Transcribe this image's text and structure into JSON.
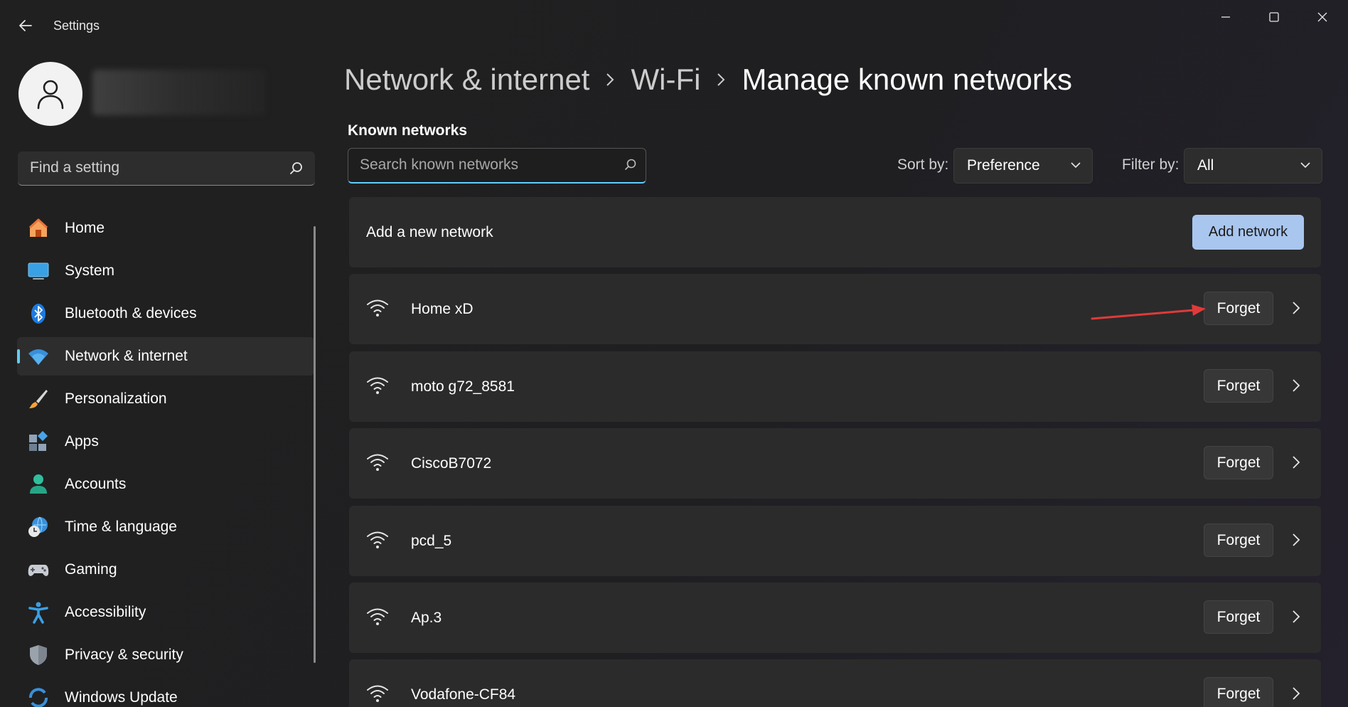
{
  "window": {
    "title": "Settings"
  },
  "sidebar": {
    "search_placeholder": "Find a setting",
    "items": [
      {
        "label": "Home",
        "icon": "home-icon"
      },
      {
        "label": "System",
        "icon": "system-icon"
      },
      {
        "label": "Bluetooth & devices",
        "icon": "bluetooth-icon"
      },
      {
        "label": "Network & internet",
        "icon": "wifi-icon",
        "active": true
      },
      {
        "label": "Personalization",
        "icon": "brush-icon"
      },
      {
        "label": "Apps",
        "icon": "apps-icon"
      },
      {
        "label": "Accounts",
        "icon": "account-icon"
      },
      {
        "label": "Time & language",
        "icon": "clock-globe-icon"
      },
      {
        "label": "Gaming",
        "icon": "gamepad-icon"
      },
      {
        "label": "Accessibility",
        "icon": "accessibility-icon"
      },
      {
        "label": "Privacy & security",
        "icon": "shield-icon"
      },
      {
        "label": "Windows Update",
        "icon": "update-icon"
      }
    ]
  },
  "breadcrumb": {
    "items": [
      "Network & internet",
      "Wi-Fi"
    ],
    "current": "Manage known networks"
  },
  "main": {
    "section_title": "Known networks",
    "search_placeholder": "Search known networks",
    "sort_label": "Sort by:",
    "sort_value": "Preference",
    "filter_label": "Filter by:",
    "filter_value": "All",
    "add_label": "Add a new network",
    "add_button": "Add network",
    "forget_label": "Forget",
    "networks": [
      "Home xD",
      "moto g72_8581",
      "CiscoB7072",
      "pcd_5",
      "Ap.3",
      "Vodafone-CF84"
    ]
  },
  "colors": {
    "accent": "#60cdff",
    "primary_button": "#a9c6ef",
    "annotation_arrow": "#e03a3a"
  }
}
